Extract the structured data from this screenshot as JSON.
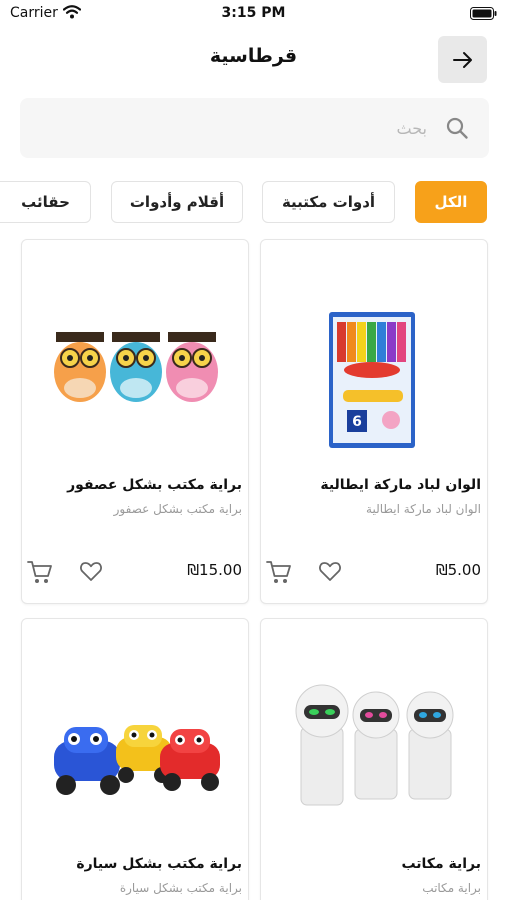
{
  "status_bar": {
    "carrier": "Carrier",
    "time": "3:15 PM"
  },
  "header": {
    "title": "قرطاسية"
  },
  "search": {
    "placeholder": "بحث"
  },
  "tabs": [
    {
      "label": "الكل",
      "active": true
    },
    {
      "label": "أدوات مكتبية",
      "active": false
    },
    {
      "label": "أقلام وأدوات",
      "active": false
    },
    {
      "label": "حقائب",
      "active": false
    }
  ],
  "products": [
    {
      "title": "الوان لباد ماركة ايطالية",
      "subtitle": "الوان لباد ماركة ايطالية",
      "price": "₪5.00",
      "image": "markers-box-image"
    },
    {
      "title": "براية مكتب بشكل عصفور",
      "subtitle": "براية مكتب بشكل عصفور",
      "price": "₪15.00",
      "image": "owl-sharpeners-image"
    },
    {
      "title": "براية مكاتب",
      "subtitle": "براية مكاتب",
      "image": "robot-sharpeners-image"
    },
    {
      "title": "براية مكتب بشكل سيارة",
      "subtitle": "براية مكتب بشكل سيارة",
      "image": "car-sharpeners-image"
    }
  ],
  "colors": {
    "accent": "#f7a11a",
    "muted_text": "#9a9a9a",
    "card_border": "#e6e6e6"
  },
  "icons": {
    "back": "arrow-right-icon",
    "search": "search-icon",
    "favorite": "heart-icon",
    "cart": "cart-icon"
  }
}
